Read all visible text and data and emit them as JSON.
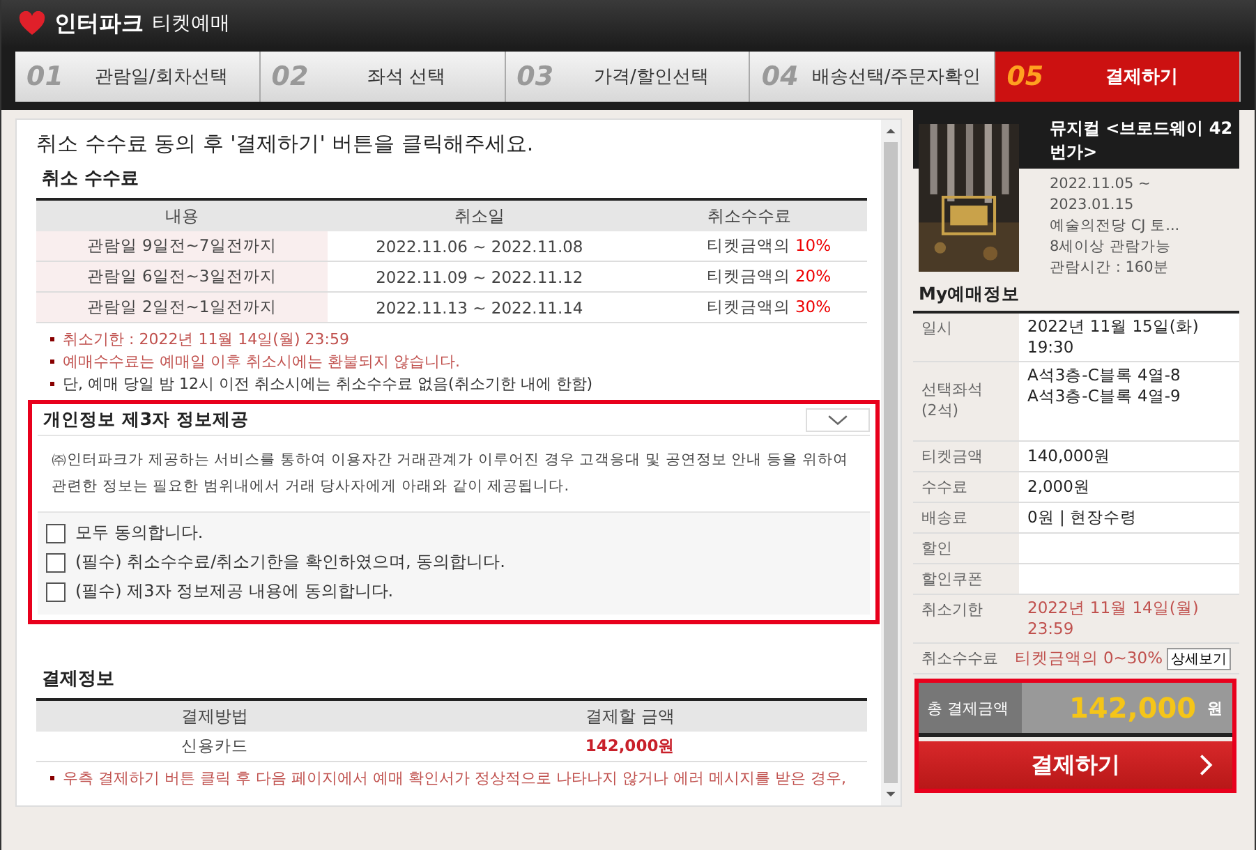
{
  "header": {
    "brand": "인터파크",
    "title": "티켓예매"
  },
  "steps": [
    {
      "number": "01",
      "label": "관람일/회차선택",
      "selected": false
    },
    {
      "number": "02",
      "label": "좌석 선택",
      "selected": false
    },
    {
      "number": "03",
      "label": "가격/할인선택",
      "selected": false
    },
    {
      "number": "04",
      "label": "배송선택/주문자확인",
      "selected": false
    },
    {
      "number": "05",
      "label": "결제하기",
      "selected": true
    }
  ],
  "instruction": "취소 수수료 동의 후 '결제하기' 버튼을 클릭해주세요.",
  "cancel_fee": {
    "title": "취소 수수료",
    "columns": [
      "내용",
      "취소일",
      "취소수수료"
    ],
    "rows": [
      {
        "period": "관람일 9일전~7일전까지",
        "dates": "2022.11.06 ~ 2022.11.08",
        "fee_prefix": "티켓금액의",
        "fee": "10%"
      },
      {
        "period": "관람일 6일전~3일전까지",
        "dates": "2022.11.09 ~ 2022.11.12",
        "fee_prefix": "티켓금액의",
        "fee": "20%"
      },
      {
        "period": "관람일 2일전~1일전까지",
        "dates": "2022.11.13 ~ 2022.11.14",
        "fee_prefix": "티켓금액의",
        "fee": "30%"
      }
    ],
    "notes": [
      {
        "text": "취소기한 : 2022년 11월 14일(월) 23:59",
        "kind": "warning"
      },
      {
        "text": "예매수수료는 예매일 이후 취소시에는 환불되지 않습니다.",
        "kind": "warning"
      },
      {
        "text": "단, 예매 당일 밤 12시 이전 취소시에는 취소수수료 없음(취소기한 내에 한함)",
        "kind": "plain"
      }
    ]
  },
  "privacy": {
    "title": "개인정보 제3자 정보제공",
    "expanded": false,
    "body": "㈜인터파크가 제공하는 서비스를 통하여 이용자간 거래관계가 이루어진 경우 고객응대 및 공연정보 안내 등을 위하여 관련한 정보는 필요한 범위내에서 거래 당사자에게 아래와 같이 제공됩니다.",
    "agreements": [
      {
        "label": "모두 동의합니다.",
        "checked": false
      },
      {
        "label": "(필수) 취소수수료/취소기한을 확인하였으며, 동의합니다.",
        "checked": false
      },
      {
        "label": "(필수) 제3자 정보제공 내용에 동의합니다.",
        "checked": false
      }
    ]
  },
  "payment_info": {
    "title": "결제정보",
    "columns": [
      "결제방법",
      "결제할 금액"
    ],
    "method": "신용카드",
    "amount": "142,000원",
    "notes": [
      "우측 결제하기 버튼 클릭 후 다음 페이지에서 예매 확인서가 정상적으로 나타나지 않거나 에러 메시지를 받은 경우,"
    ]
  },
  "show": {
    "title": "뮤지컬 <브로드웨이 42번가>",
    "details": [
      "2022.11.05 ~",
      "2023.01.15",
      "예술의전당 CJ 토...",
      "8세이상 관람가능",
      "관람시간 : 160분"
    ]
  },
  "my_booking": {
    "title": "My예매정보",
    "rows": [
      {
        "label": "일시",
        "values": [
          "2022년 11월 15일(화)",
          "19:30"
        ],
        "kind": "plain"
      },
      {
        "label": "선택좌석(2석)",
        "values": [
          "A석3층-C블록 4열-8",
          "A석3층-C블록 4열-9"
        ],
        "kind": "seats"
      },
      {
        "label": "티켓금액",
        "values": [
          "140,000원"
        ],
        "kind": "plain"
      },
      {
        "label": "수수료",
        "values": [
          "2,000원"
        ],
        "kind": "plain"
      },
      {
        "label": "배송료",
        "values": [
          "0원 | 현장수령"
        ],
        "kind": "plain"
      },
      {
        "label": "할인",
        "values": [],
        "kind": "plain"
      },
      {
        "label": "할인쿠폰",
        "values": [],
        "kind": "plain"
      },
      {
        "label": "취소기한",
        "values": [
          "2022년 11월 14일(월)",
          "23:59"
        ],
        "kind": "warning"
      },
      {
        "label": "취소수수료",
        "values": [
          "티켓금액의 0~30%"
        ],
        "kind": "warning",
        "button": "상세보기"
      }
    ]
  },
  "total": {
    "label": "총 결제금액",
    "amount": "142,000",
    "unit": "원"
  },
  "pay_button": "결제하기"
}
